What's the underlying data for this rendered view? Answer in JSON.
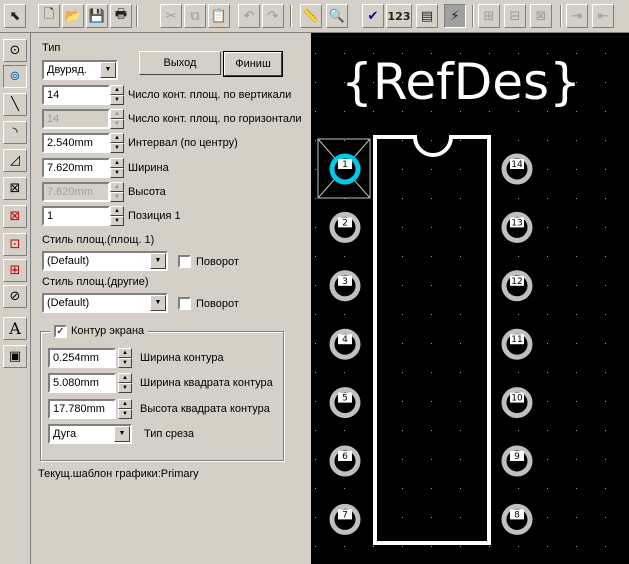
{
  "toolbar": {
    "buttons": [
      {
        "name": "select-tool-button",
        "icon": "pointer-icon",
        "glyph": "⬉"
      },
      {
        "name": "new-button",
        "icon": "new-file-icon",
        "glyph": "🗋"
      },
      {
        "name": "open-button",
        "icon": "open-folder-icon",
        "glyph": "📂"
      },
      {
        "name": "save-button",
        "icon": "save-disk-icon",
        "glyph": "💾"
      },
      {
        "name": "print-button",
        "icon": "printer-icon",
        "glyph": "🖶"
      },
      {
        "name": "cut-button",
        "icon": "scissors-icon",
        "glyph": "✂"
      },
      {
        "name": "copy-button",
        "icon": "copy-icon",
        "glyph": "⧉"
      },
      {
        "name": "paste-button",
        "icon": "paste-icon",
        "glyph": "📋"
      },
      {
        "name": "undo-button",
        "icon": "undo-icon",
        "glyph": "↶"
      },
      {
        "name": "redo-button",
        "icon": "redo-icon",
        "glyph": "↷"
      },
      {
        "name": "measure-button",
        "icon": "ruler-icon",
        "glyph": "📏"
      },
      {
        "name": "zoom-button",
        "icon": "magnifier-icon",
        "glyph": "🔍"
      },
      {
        "name": "check-button",
        "icon": "checkmark-icon",
        "glyph": "✔"
      },
      {
        "name": "numbering-button",
        "icon": "numbering-icon",
        "glyph": "123"
      },
      {
        "name": "properties-button",
        "icon": "properties-icon",
        "glyph": "▤"
      },
      {
        "name": "route-button",
        "icon": "lightning-icon",
        "glyph": "⚡"
      },
      {
        "name": "align-button",
        "icon": "align-icon",
        "glyph": "⊞"
      },
      {
        "name": "distribute-button",
        "icon": "distribute-icon",
        "glyph": "⊟"
      },
      {
        "name": "arrange-button",
        "icon": "arrange-icon",
        "glyph": "⊠"
      },
      {
        "name": "push-right-button",
        "icon": "push-right-icon",
        "glyph": "⇥"
      },
      {
        "name": "push-left-button",
        "icon": "push-left-icon",
        "glyph": "⇤"
      }
    ]
  },
  "palette": [
    {
      "name": "place-pad-tool",
      "icon": "pad-icon",
      "glyph": "⊙"
    },
    {
      "name": "place-via-tool",
      "icon": "via-icon",
      "glyph": "⊚"
    },
    {
      "name": "line-tool",
      "icon": "line-icon",
      "glyph": "╲"
    },
    {
      "name": "arc-tool",
      "icon": "arc-icon",
      "glyph": "◝"
    },
    {
      "name": "polygon-tool",
      "icon": "polygon-icon",
      "glyph": "◿"
    },
    {
      "name": "rectangle-tool",
      "icon": "rectangle-icon",
      "glyph": "⊠"
    },
    {
      "name": "fill-tool",
      "icon": "fill-rect-icon",
      "glyph": "⊠"
    },
    {
      "name": "keepout-tool",
      "icon": "keepout-icon",
      "glyph": "⊡"
    },
    {
      "name": "copper-pour-tool",
      "icon": "copper-pour-icon",
      "glyph": "⊞"
    },
    {
      "name": "no-entry-tool",
      "icon": "no-entry-icon",
      "glyph": "⊘"
    },
    {
      "name": "text-tool",
      "icon": "text-icon",
      "glyph": "A"
    },
    {
      "name": "attribute-tool",
      "icon": "attribute-icon",
      "glyph": "▣"
    }
  ],
  "form": {
    "type_label": "Тип",
    "type_value": "Двуряд.",
    "exit_button": "Выход",
    "finish_button": "Финиш",
    "pads_vertical_value": "14",
    "pads_vertical_label": "Число конт. площ. по вертикали",
    "pads_horizontal_value": "14",
    "pads_horizontal_label": "Число конт. площ. по горизонтали",
    "pitch_value": "2.540mm",
    "pitch_label": "Интервал (по центру)",
    "width_value": "7.620mm",
    "width_label": "Ширина",
    "height_value": "7.620mm",
    "height_label": "Высота",
    "position_value": "1",
    "position_label": "Позиция 1",
    "pad_style_1_label": "Стиль площ.(площ. 1)",
    "pad_style_1_value": "(Default)",
    "rotate_label_1": "Поворот",
    "pad_style_other_label": "Стиль площ.(другие)",
    "pad_style_other_value": "(Default)",
    "rotate_label_2": "Поворот",
    "outline_group_label": "Контур экрана",
    "outline_width_value": "0.254mm",
    "outline_width_label": "Ширина контура",
    "outline_box_width_value": "5.080mm",
    "outline_box_width_label": "Ширина квадрата контура",
    "outline_box_height_value": "17.780mm",
    "outline_box_height_label": "Высота квадрата контура",
    "notch_type_value": "Дуга",
    "notch_type_label": "Тип среза",
    "current_template": "Текущ.шаблон графики:Primary"
  },
  "canvas": {
    "refdes_text": "{RefDes}",
    "pads_left": [
      "1",
      "2",
      "3",
      "4",
      "5",
      "6",
      "7"
    ],
    "pads_right": [
      "14",
      "13",
      "12",
      "11",
      "10",
      "9",
      "8"
    ],
    "colors": {
      "background": "#000000",
      "silkscreen": "#ffffff",
      "pad": "#c0c0c0",
      "selected_pad": "#00c8e6"
    }
  }
}
